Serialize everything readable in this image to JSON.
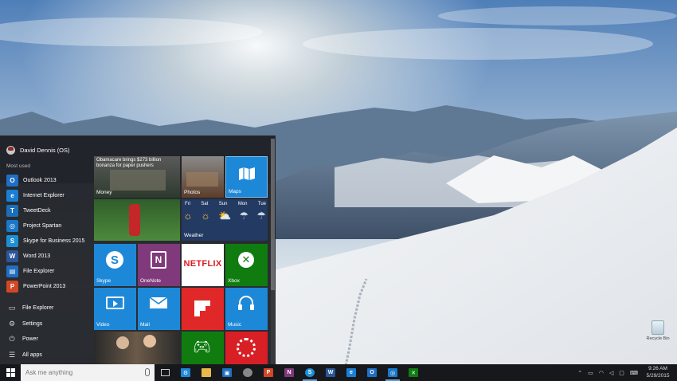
{
  "user": {
    "name": "David Dennis (OS)"
  },
  "start_menu": {
    "most_used_label": "Most used",
    "most_used": [
      {
        "label": "Outlook 2013",
        "icon": "outlook-icon",
        "color": "#1f6fc4",
        "glyph": "O"
      },
      {
        "label": "Internet Explorer",
        "icon": "internet-explorer-icon",
        "color": "#1a7fd4",
        "glyph": "e"
      },
      {
        "label": "TweetDeck",
        "icon": "tweetdeck-icon",
        "color": "#1b6fb8",
        "glyph": "T"
      },
      {
        "label": "Project Spartan",
        "icon": "project-spartan-icon",
        "color": "#1a78c8",
        "glyph": "◎"
      },
      {
        "label": "Skype for Business 2015",
        "icon": "skype-business-icon",
        "color": "#1d8fd6",
        "glyph": "S"
      },
      {
        "label": "Word 2013",
        "icon": "word-icon",
        "color": "#2b579a",
        "glyph": "W"
      },
      {
        "label": "File Explorer",
        "icon": "file-explorer-icon",
        "color": "#1f6fc4",
        "glyph": "▤"
      },
      {
        "label": "PowerPoint 2013",
        "icon": "powerpoint-icon",
        "color": "#d24726",
        "glyph": "P"
      }
    ],
    "system": [
      {
        "label": "File Explorer",
        "icon": "folder-icon",
        "glyph": "▭"
      },
      {
        "label": "Settings",
        "icon": "gear-icon",
        "glyph": "⚙"
      },
      {
        "label": "Power",
        "icon": "power-icon",
        "glyph": "⏻"
      },
      {
        "label": "All apps",
        "icon": "all-apps-icon",
        "glyph": "☰"
      }
    ],
    "tiles": {
      "money": {
        "headline": "Obamacare brings $273 billion bonanza for paper pushers",
        "label": "Money"
      },
      "photos": {
        "label": "Photos"
      },
      "maps": {
        "label": "Maps"
      },
      "weather": {
        "label": "Weather",
        "days": [
          "Fri",
          "Sat",
          "Sun",
          "Mon",
          "Tue"
        ]
      },
      "skype": {
        "label": "Skype"
      },
      "onenote": {
        "label": "OneNote"
      },
      "netflix": {
        "label": "NETFLIX"
      },
      "xbox": {
        "label": "Xbox"
      },
      "video": {
        "label": "Video"
      },
      "mail": {
        "label": "Mail"
      },
      "music": {
        "label": "Music"
      }
    }
  },
  "taskbar": {
    "search_placeholder": "Ask me anything",
    "clock_time": "9:26 AM",
    "clock_date": "5/29/2015"
  },
  "desktop": {
    "recycle_bin_label": "Recycle Bin"
  },
  "colors": {
    "tile_blue": "#1e88d8",
    "netflix": "#ffffff",
    "onenote": "#80397b",
    "xbox": "#107c10",
    "flipboard": "#e12828"
  }
}
